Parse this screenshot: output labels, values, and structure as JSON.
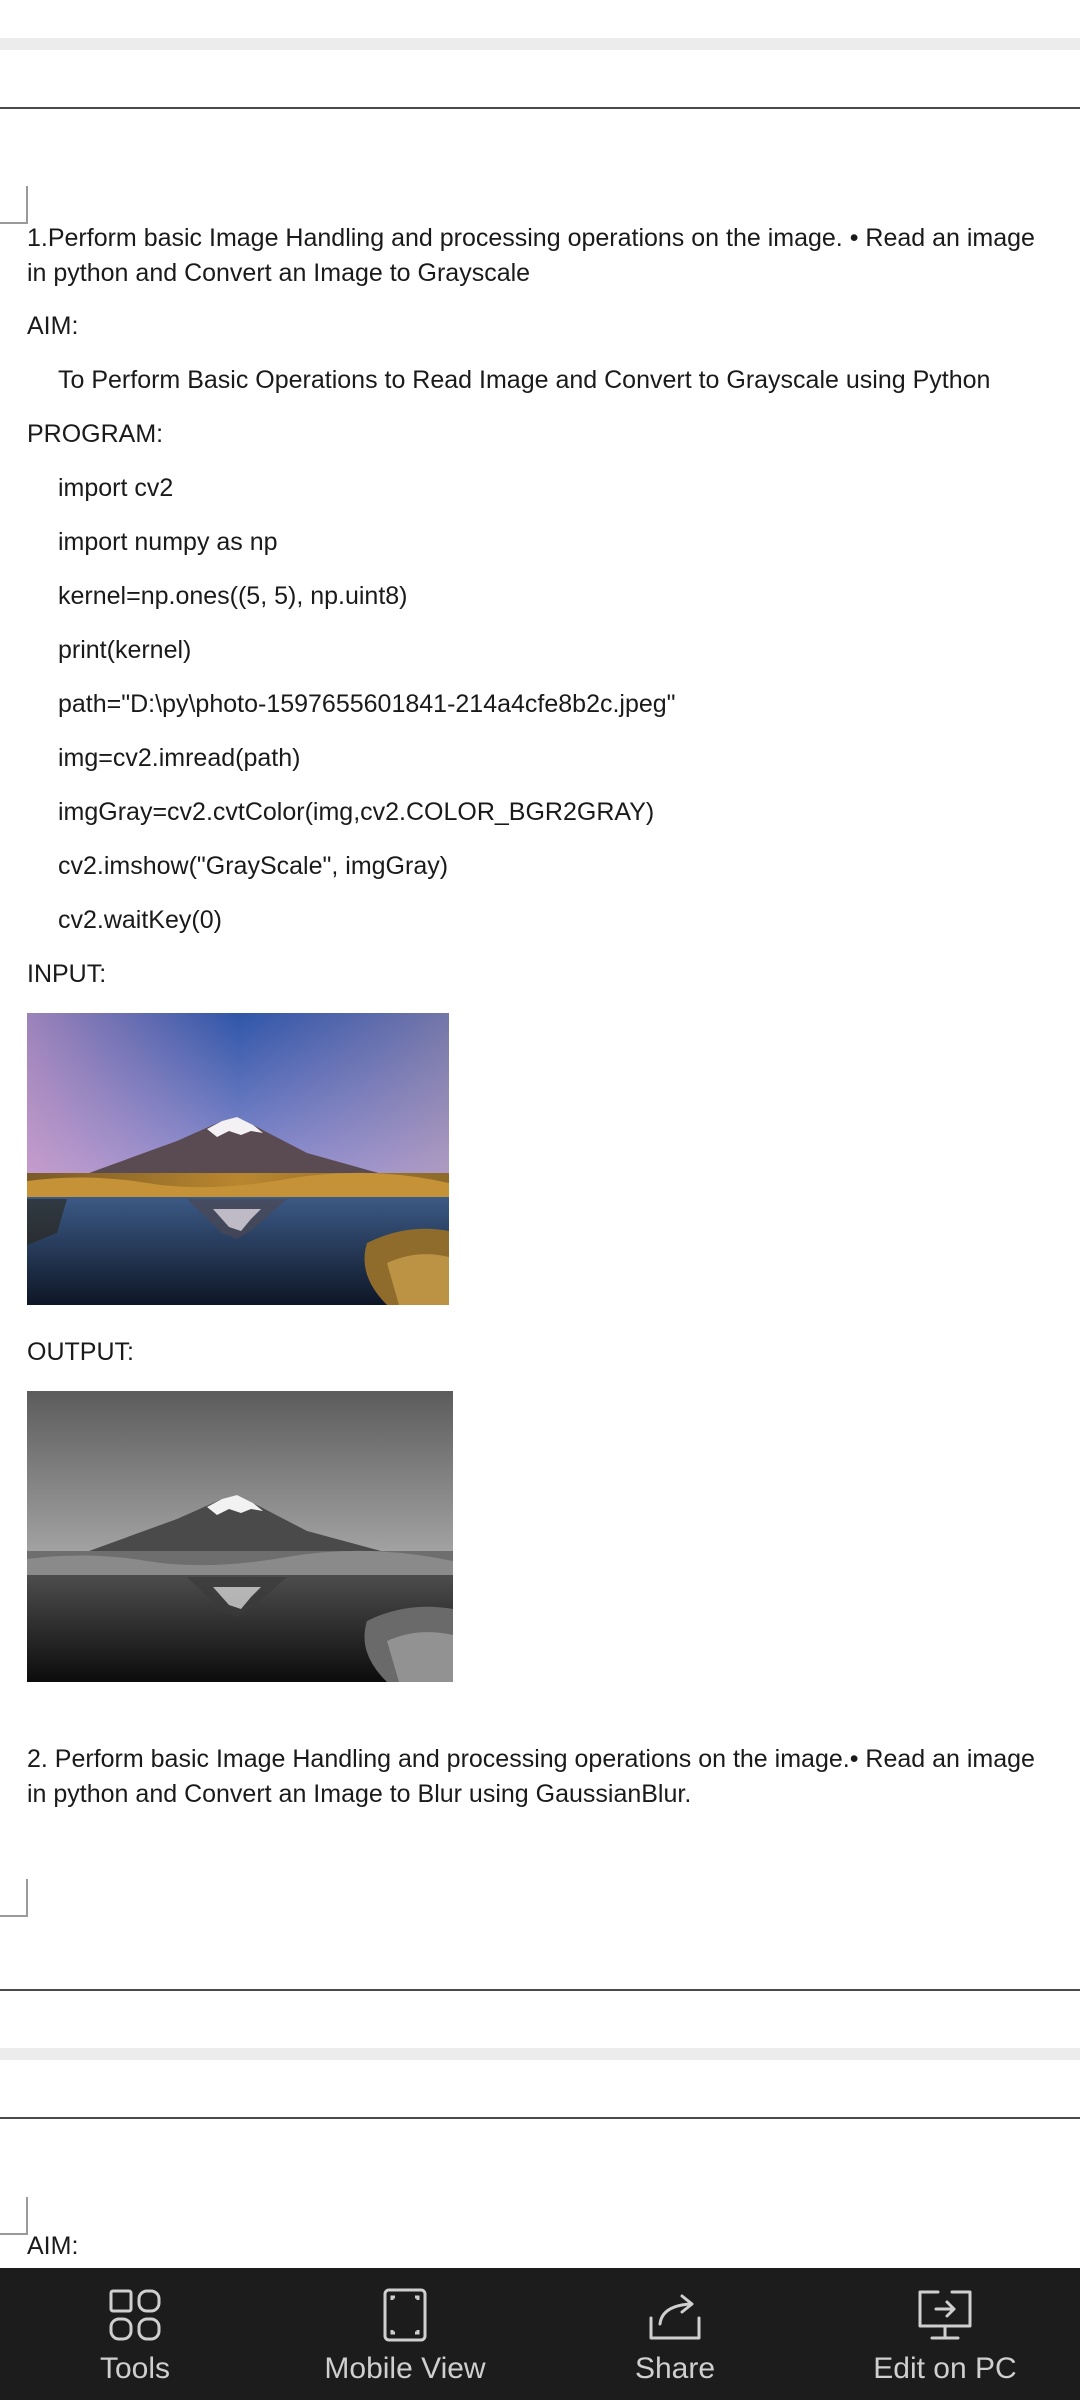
{
  "document": {
    "question1": "1.Perform basic Image Handling and processing operations on the image. • Read an image in python and Convert an Image to Grayscale",
    "aim_label": "AIM:",
    "aim_text": "To Perform Basic Operations to Read Image and Convert to Grayscale using Python",
    "program_label": "PROGRAM:",
    "code_lines": [
      "import cv2",
      "import numpy as np",
      "kernel=np.ones((5, 5), np.uint8)",
      "print(kernel)",
      "path=\"D:\\py\\photo-1597655601841-214a4cfe8b2c.jpeg\"",
      "img=cv2.imread(path)",
      "imgGray=cv2.cvtColor(img,cv2.COLOR_BGR2GRAY)",
      "cv2.imshow(\"GrayScale\", imgGray)",
      "cv2.waitKey(0)"
    ],
    "input_label": "INPUT:",
    "output_label": "OUTPUT:",
    "question2": "2. Perform basic Image Handling and processing operations on the image.• Read an image in python and Convert an Image to Blur using GaussianBlur.",
    "next_page_aim_label": "AIM:"
  },
  "toolbar": {
    "items": [
      {
        "label": "Tools",
        "icon": "tools-grid-icon"
      },
      {
        "label": "Mobile View",
        "icon": "mobile-view-icon"
      },
      {
        "label": "Share",
        "icon": "share-icon"
      },
      {
        "label": "Edit on PC",
        "icon": "monitor-icon"
      }
    ]
  }
}
